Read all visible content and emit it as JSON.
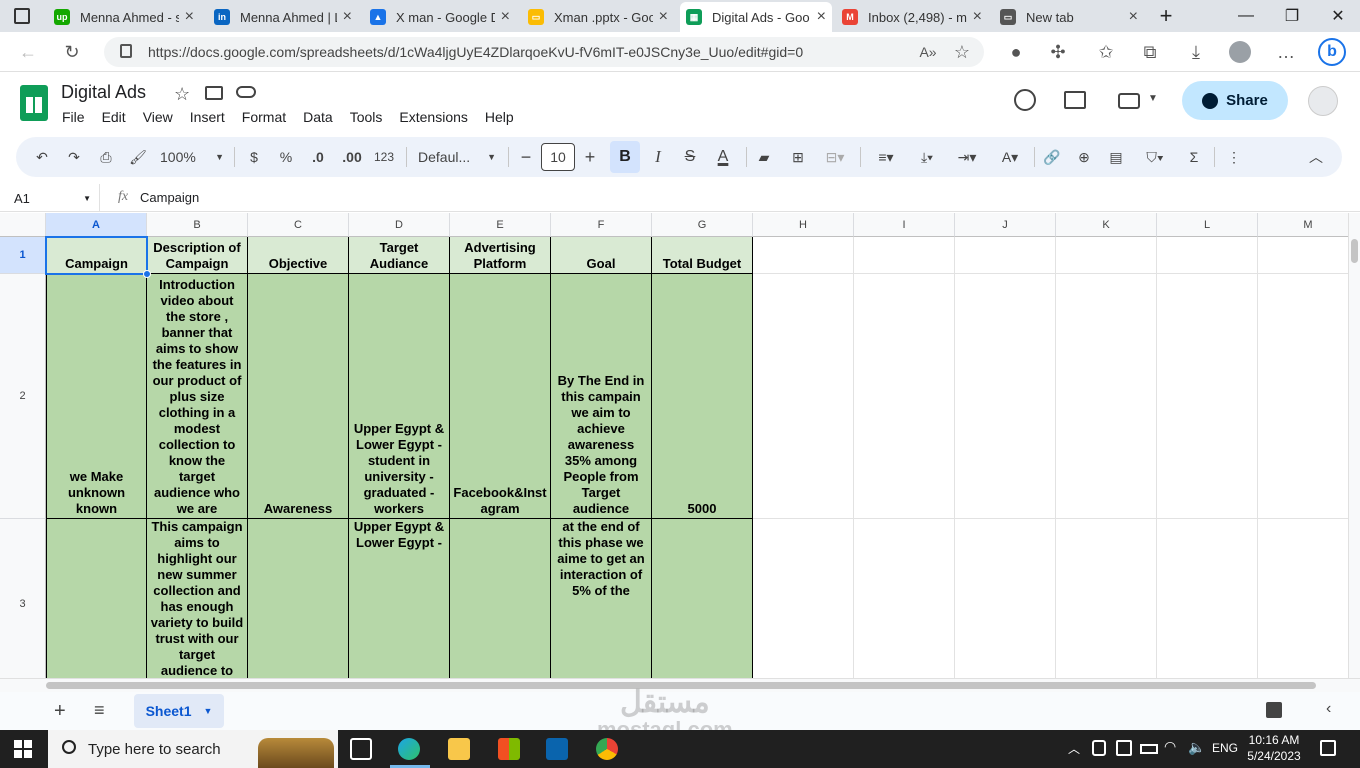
{
  "browser": {
    "tabs": [
      {
        "title": "Menna Ahmed - s",
        "color": "#14a800",
        "glyph": "up"
      },
      {
        "title": "Menna Ahmed | L",
        "color": "#0a66c2",
        "glyph": "in"
      },
      {
        "title": "X man - Google D",
        "color": "#1a73e8",
        "glyph": "▲"
      },
      {
        "title": "Xman .pptx - Goo",
        "color": "#fbbc04",
        "glyph": "▭"
      },
      {
        "title": "Digital Ads - Goo",
        "color": "#0f9d58",
        "glyph": "▦"
      },
      {
        "title": "Inbox (2,498) - m",
        "color": "#ea4335",
        "glyph": "M"
      },
      {
        "title": "New tab",
        "color": "#555555",
        "glyph": "▭"
      }
    ],
    "url": "https://docs.google.com/spreadsheets/d/1cWa4ljgUyE4ZDlarqoeKvU-fV6mIT-e0JSCny3e_Uuo/edit#gid=0"
  },
  "sheets": {
    "title": "Digital Ads",
    "menu": [
      "File",
      "Edit",
      "View",
      "Insert",
      "Format",
      "Data",
      "Tools",
      "Extensions",
      "Help"
    ],
    "share_label": "Share",
    "toolbar": {
      "zoom": "100%",
      "currency": "$",
      "percent": "%",
      "dec_decrease": ".0",
      "dec_increase": ".00",
      "number_format": "123",
      "font": "Defaul...",
      "font_size": "10",
      "bold": "B",
      "italic": "I",
      "strike": "S",
      "text_color": "A"
    },
    "name_box": "A1",
    "formula": "Campaign",
    "columns": [
      "A",
      "B",
      "C",
      "D",
      "E",
      "F",
      "G",
      "H",
      "I",
      "J",
      "K",
      "L",
      "M"
    ],
    "rows": [
      "1",
      "2",
      "3"
    ],
    "header_row": [
      "Campaign",
      "Description of Campaign",
      "Objective",
      "Target Audiance",
      "Advertising Platform",
      "Goal",
      "Total Budget"
    ],
    "data_rows": [
      [
        "we Make unknown known",
        "Introduction video about the store , banner that aims to show the features in our product of plus size clothing in a modest collection to know the target audience who we are",
        "Awareness",
        "Upper Egypt & Lower Egypt - student in university - graduated - workers",
        "Facebook&Instagram",
        "By The End in this campain we aim to achieve awareness 35% among People from Target audience",
        "5000"
      ],
      [
        "",
        "This campaign aims to highlight our new summer collection and has enough variety to build trust with our target audience to",
        "",
        "Upper Egypt & Lower Egypt -",
        "",
        "at the end of this phase we aime to get an interaction of 5% of the",
        ""
      ]
    ],
    "sheet_tab": "Sheet1"
  },
  "taskbar": {
    "search_placeholder": "Type here to search",
    "lang": "ENG",
    "time": "10:16 AM",
    "date": "5/24/2023"
  },
  "watermark": {
    "line1": "مستقل",
    "line2": "mostaql.com"
  }
}
